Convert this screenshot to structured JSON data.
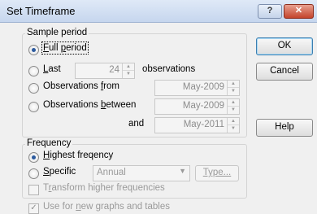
{
  "window": {
    "title": "Set Timeframe",
    "help_glyph": "?",
    "close_glyph": "✕"
  },
  "sample_period": {
    "legend": "Sample period",
    "full_period": {
      "label_u": "F",
      "label_rest": "ull ",
      "label_u2": "p",
      "label_rest2": "eriod"
    },
    "last": {
      "label_u": "L",
      "label_rest": "ast",
      "value": "24",
      "suffix": "observations"
    },
    "from": {
      "label_pre": "Observations ",
      "label_u": "f",
      "label_rest": "rom",
      "value": "May-2009"
    },
    "between": {
      "label_pre": "Observations ",
      "label_u": "b",
      "label_rest": "etween",
      "value1": "May-2009",
      "and_label": "and",
      "value2": "May-2011"
    }
  },
  "frequency": {
    "legend": "Frequency",
    "highest": {
      "label_u": "H",
      "label_rest": "ighest freqency"
    },
    "specific": {
      "label_u": "S",
      "label_rest": "pecific",
      "select_value": "Annual",
      "type_button": "Type..."
    },
    "transform": {
      "label_pre": "T",
      "label_u": "r",
      "label_rest": "ansform higher frequencies"
    }
  },
  "use_for_new": {
    "label_pre": "Use for ",
    "label_u": "n",
    "label_rest": "ew graphs and tables",
    "checked_glyph": "✓"
  },
  "buttons": {
    "ok": "OK",
    "cancel": "Cancel",
    "help": "Help"
  },
  "arrows": {
    "up": "▲",
    "down": "▼",
    "dropdown": "▼"
  }
}
